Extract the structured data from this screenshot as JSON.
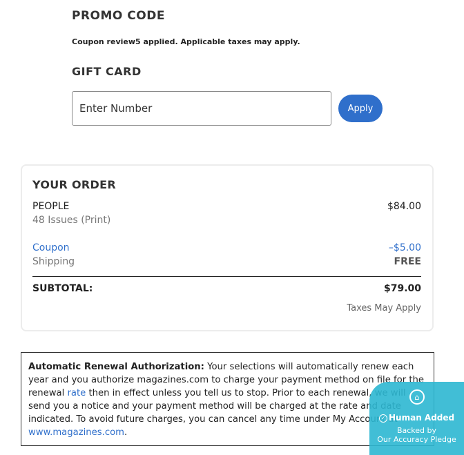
{
  "promo": {
    "title": "PROMO CODE",
    "note": "Coupon review5 applied. Applicable taxes may apply."
  },
  "gift_card": {
    "title": "GIFT CARD",
    "placeholder": "Enter Number",
    "apply_label": "Apply"
  },
  "order": {
    "title": "YOUR ORDER",
    "item_name": "PEOPLE",
    "item_detail": "48 Issues (Print)",
    "item_price": "$84.00",
    "coupon_label": "Coupon",
    "coupon_value": "–$5.00",
    "shipping_label": "Shipping",
    "shipping_value": "FREE",
    "subtotal_label": "SUBTOTAL:",
    "subtotal_value": "$79.00",
    "taxes_note": "Taxes May Apply"
  },
  "renewal": {
    "heading": "Automatic Renewal Authorization:",
    "text_1": " Your selections will automatically renew each year and you authorize magazines.com to charge your payment method on file for the renewal ",
    "rate_link": "rate",
    "text_2": " then in effect unless you tell us to stop. Prior to each renewal, we will send you a notice and your payment method will be charged at the rate and date indicated. To avoid future charges, you can cancel any time under My Account at ",
    "site_link": "www.magazines.com",
    "text_3": "."
  },
  "badge": {
    "title": "Human Added",
    "line1": "Backed by",
    "line2": "Our Accuracy Pledge"
  },
  "colors": {
    "accent": "#2f6fcb",
    "badge": "#2cb7d2"
  }
}
